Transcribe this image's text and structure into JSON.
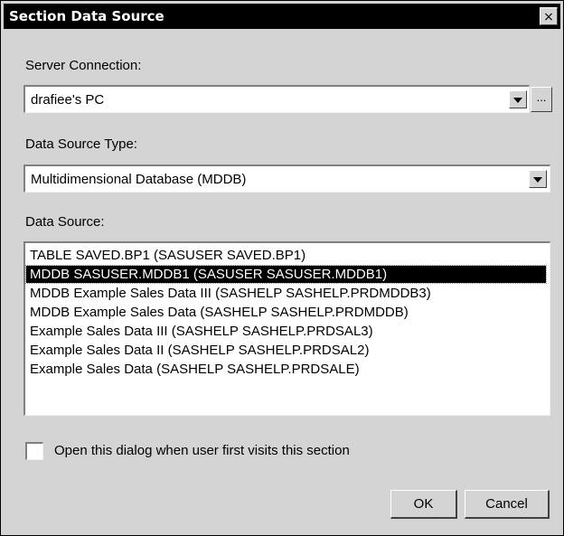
{
  "window": {
    "title": "Section Data Source",
    "close_symbol": "×"
  },
  "server_connection": {
    "label": "Server Connection:",
    "value": "drafiee's PC",
    "browse_label": "..."
  },
  "data_source_type": {
    "label": "Data Source Type:",
    "value": "Multidimensional Database (MDDB)"
  },
  "data_source": {
    "label": "Data Source:",
    "items": [
      "TABLE SAVED.BP1 (SASUSER SAVED.BP1)",
      "MDDB SASUSER.MDDB1 (SASUSER SASUSER.MDDB1)",
      "MDDB Example Sales Data III (SASHELP SASHELP.PRDMDDB3)",
      "MDDB Example Sales Data (SASHELP SASHELP.PRDMDDB)",
      "Example Sales Data III (SASHELP SASHELP.PRDSAL3)",
      "Example Sales Data II (SASHELP SASHELP.PRDSAL2)",
      "Example Sales Data (SASHELP SASHELP.PRDSALE)"
    ],
    "selected_index": 1
  },
  "open_dialog_checkbox": {
    "label": "Open this dialog when user first visits this section",
    "checked": false
  },
  "buttons": {
    "ok_label": "OK",
    "cancel_label": "Cancel"
  }
}
